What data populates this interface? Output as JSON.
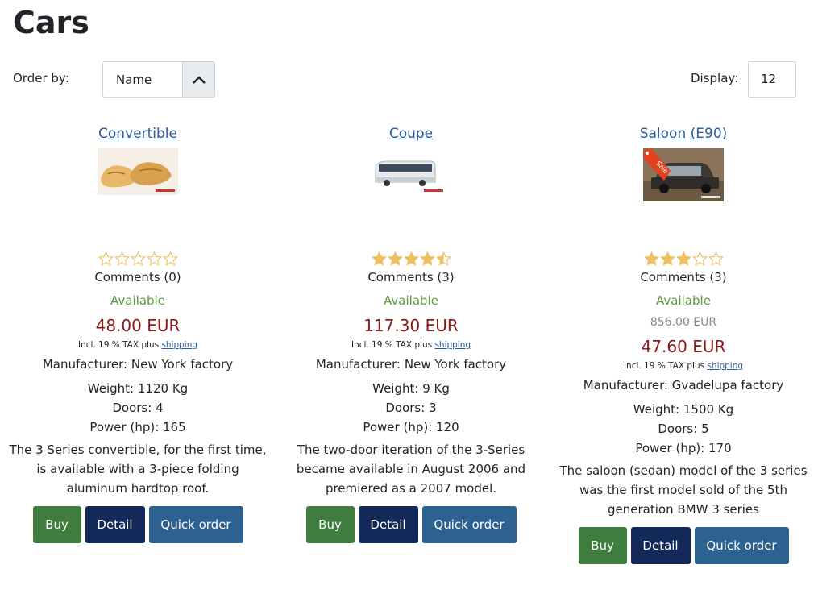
{
  "page": {
    "title": "Cars"
  },
  "toolbar": {
    "order_label": "Order by:",
    "order_value": "Name",
    "display_label": "Display:",
    "display_value": "12"
  },
  "products": [
    {
      "name": "Convertible",
      "rating": 0,
      "comments": "Comments (0)",
      "availability": "Available",
      "price": "48.00 EUR",
      "tax_text": "Incl. 19 % TAX plus",
      "shipping_link": "shipping",
      "manufacturer": "Manufacturer: New York factory",
      "weight": "Weight: 1120 Kg",
      "doors": "Doors: 4",
      "power": "Power (hp): 165",
      "description": "The 3 Series convertible, for the first time, is available with a 3-piece folding aluminum hardtop roof.",
      "buy_label": "Buy",
      "detail_label": "Detail",
      "quick_label": "Quick order"
    },
    {
      "name": "Coupe",
      "rating": 4.5,
      "comments": "Comments (3)",
      "availability": "Available",
      "price": "117.30 EUR",
      "tax_text": "Incl. 19 % TAX plus",
      "shipping_link": "shipping",
      "manufacturer": "Manufacturer: New York factory",
      "weight": "Weight: 9 Kg",
      "doors": "Doors: 3",
      "power": "Power (hp): 120",
      "description": "The two-door iteration of the 3-Series became available in August 2006 and premiered as a 2007 model.",
      "buy_label": "Buy",
      "detail_label": "Detail",
      "quick_label": "Quick order"
    },
    {
      "name": "Saloon (E90)",
      "rating": 3,
      "comments": "Comments (3)",
      "availability": "Available",
      "old_price": "856.00 EUR",
      "price": "47.60 EUR",
      "tax_text": "Incl. 19 % TAX plus",
      "shipping_link": "shipping",
      "manufacturer": "Manufacturer: Gvadelupa factory",
      "weight": "Weight: 1500 Kg",
      "doors": "Doors: 5",
      "power": "Power (hp): 170",
      "description": "The saloon (sedan) model of the 3 series was the first model sold of the 5th generation BMW 3 series",
      "sale_badge": "Sale",
      "buy_label": "Buy",
      "detail_label": "Detail",
      "quick_label": "Quick order"
    }
  ],
  "colors": {
    "price": "#8b1a1a",
    "available": "#5b9a3c",
    "buy": "#3f7d3f",
    "detail": "#13295a",
    "quick": "#2d6290",
    "star": "#f0c060"
  }
}
